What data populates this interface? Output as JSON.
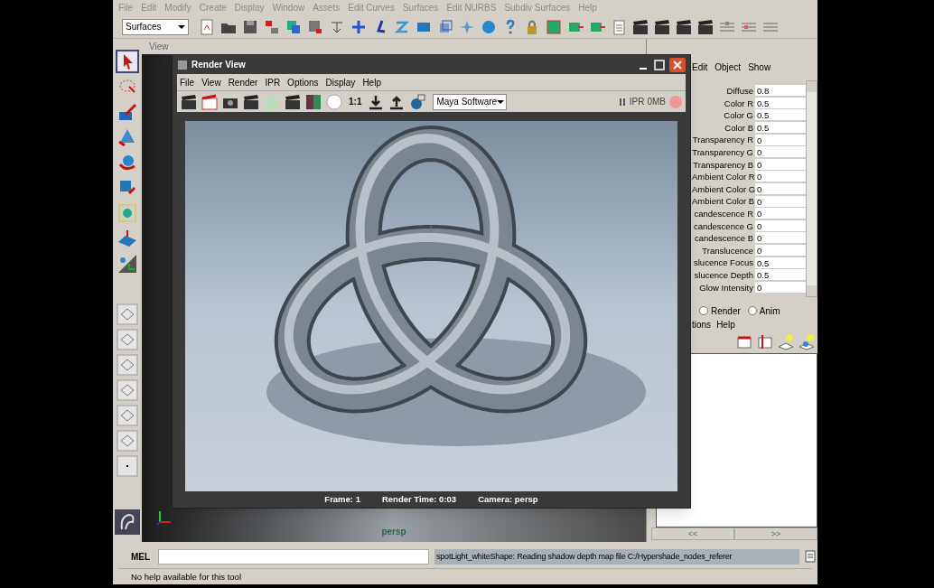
{
  "main_menu": [
    "File",
    "Edit",
    "Modify",
    "Create",
    "Display",
    "Window",
    "Assets",
    "Edit Curves",
    "Surfaces",
    "Edit NURBS",
    "Subdiv Surfaces",
    "Help"
  ],
  "shelf": {
    "menu_set": "Surfaces"
  },
  "panel_menu": [
    "View"
  ],
  "render_view": {
    "title": "Render View",
    "menu": [
      "File",
      "View",
      "Render",
      "IPR",
      "Options",
      "Display",
      "Help"
    ],
    "zoom_label": "1:1",
    "renderer": "Maya Software",
    "ipr": "IPR",
    "memory": "0MB",
    "status": [
      "Frame: 1",
      "Render Time: 0:03",
      "Camera: persp"
    ]
  },
  "viewport": {
    "camera_label": "persp"
  },
  "attribute_editor": {
    "menu": [
      "Edit",
      "Object",
      "Show"
    ],
    "attributes": [
      {
        "label": "Diffuse",
        "value": "0.8"
      },
      {
        "label": "Color R",
        "value": "0.5"
      },
      {
        "label": "Color G",
        "value": "0.5"
      },
      {
        "label": "Color B",
        "value": "0.5"
      },
      {
        "label": "Transparency R",
        "value": "0"
      },
      {
        "label": "Transparency G",
        "value": "0"
      },
      {
        "label": "Transparency B",
        "value": "0"
      },
      {
        "label": "Ambient Color R",
        "value": "0"
      },
      {
        "label": "Ambient Color G",
        "value": "0"
      },
      {
        "label": "Ambient Color B",
        "value": "0"
      },
      {
        "label": "candescence R",
        "value": "0"
      },
      {
        "label": "candescence G",
        "value": "0"
      },
      {
        "label": "candescence B",
        "value": "0"
      },
      {
        "label": "Translucence",
        "value": "0"
      },
      {
        "label": "slucence Focus",
        "value": "0.5"
      },
      {
        "label": "slucence Depth",
        "value": "0.5"
      },
      {
        "label": "Glow Intensity",
        "value": "0"
      }
    ],
    "radios": [
      {
        "label": "Render",
        "selected": false
      },
      {
        "label": "Anim",
        "selected": false
      }
    ],
    "menu2": [
      "tions",
      "Help"
    ],
    "nav": [
      "<<",
      ">>"
    ]
  },
  "command_line": {
    "label": "MEL",
    "response": "spotLight_whiteShape: Reading shadow depth map file C:/Hypershade_nodes_referer"
  },
  "help_line": "No help available for this tool"
}
